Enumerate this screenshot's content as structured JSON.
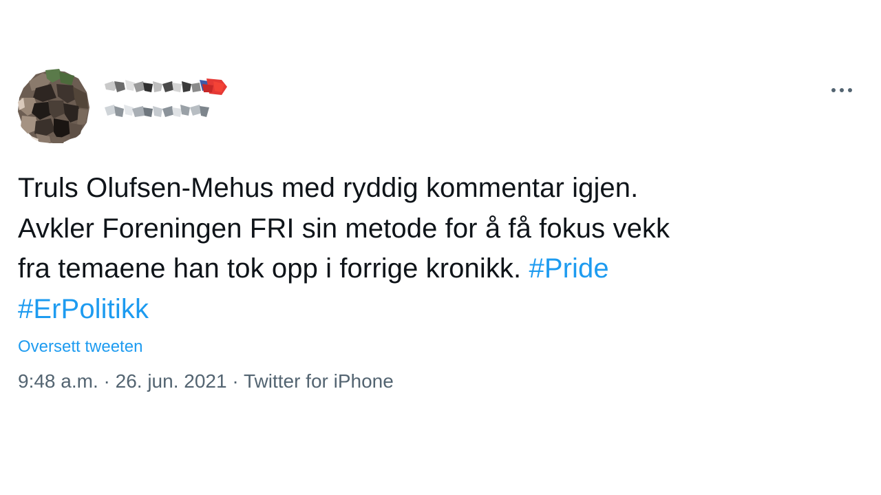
{
  "tweet": {
    "text_lines": [
      "Truls Olufsen-Mehus med ryddig kommentar igjen.",
      "Avkler Foreningen FRI sin metode for å få fokus vekk",
      "fra temaene han tok opp i forrige kronikk."
    ],
    "hashtags": [
      "#Pride",
      "#ErPolitikk"
    ],
    "translate_label": "Oversett tweeten",
    "time": "9:48 a.m.",
    "separator": "·",
    "date": "26. jun. 2021",
    "source": "Twitter for iPhone",
    "more_icon": "more-horizontal-icon",
    "hashtag_color": "#1d9bf0",
    "text_color": "#0f1419",
    "meta_color": "#536471"
  }
}
